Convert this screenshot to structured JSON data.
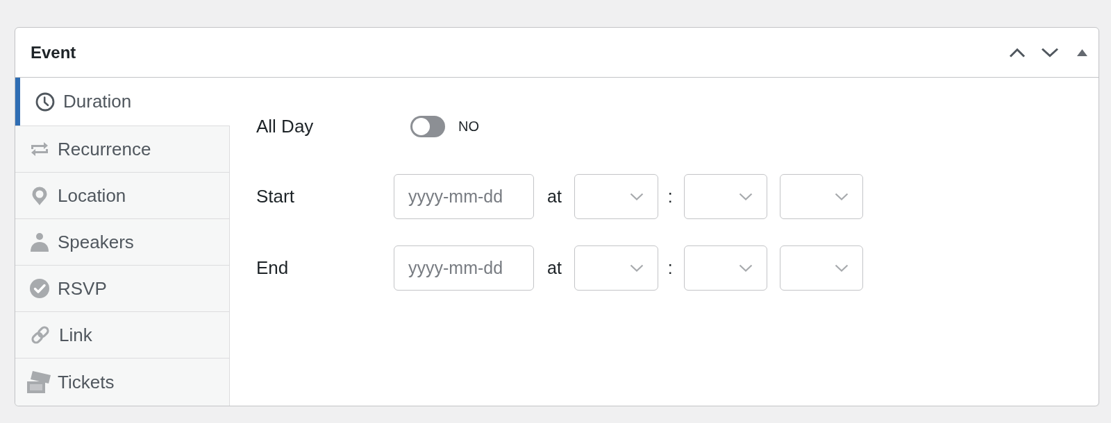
{
  "panel": {
    "title": "Event",
    "expanded": true
  },
  "tabs": [
    {
      "label": "Duration",
      "selected": true
    },
    {
      "label": "Recurrence",
      "selected": false
    },
    {
      "label": "Location",
      "selected": false
    },
    {
      "label": "Speakers",
      "selected": false
    },
    {
      "label": "RSVP",
      "selected": false
    },
    {
      "label": "Link",
      "selected": false
    },
    {
      "label": "Tickets",
      "selected": false
    }
  ],
  "duration": {
    "all_day": {
      "label": "All Day",
      "on": false,
      "state_text": "NO"
    },
    "rows": [
      {
        "label": "Start",
        "date": {
          "placeholder": "yyyy-mm-dd"
        },
        "at": "at",
        "separator": ":"
      },
      {
        "label": "End",
        "date": {
          "placeholder": "yyyy-mm-dd"
        },
        "at": "at",
        "separator": ":"
      }
    ]
  }
}
